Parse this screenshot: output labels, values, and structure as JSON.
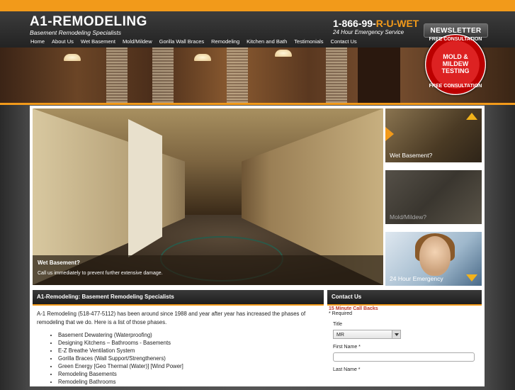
{
  "header": {
    "logo_title": "A1-REMODELING",
    "logo_subtitle": "Basement Remodeling Specialists",
    "phone_prefix": "1-866-99-",
    "phone_highlight": "R-U-WET",
    "phone_subtitle": "24 Hour Emergency Service",
    "newsletter_label": "NEWSLETTER"
  },
  "nav": {
    "items": [
      {
        "label": "Home"
      },
      {
        "label": "About Us"
      },
      {
        "label": "Wet Basement"
      },
      {
        "label": "Mold/Mildew"
      },
      {
        "label": "Gorilla Wall Braces"
      },
      {
        "label": "Remodeling"
      },
      {
        "label": "Kitchen and Bath"
      },
      {
        "label": "Testimonials"
      },
      {
        "label": "Contact Us"
      }
    ]
  },
  "badge": {
    "top_text": "FREE CONSULTATION",
    "line1": "MOLD &",
    "line2": "MILDEW",
    "line3": "TESTING",
    "bottom_text": "FREE CONSULTATION"
  },
  "hero": {
    "title": "Wet Basement?",
    "text": "Call us immediately to prevent further extensive damage."
  },
  "thumbs": [
    {
      "label": "Wet Basement?"
    },
    {
      "label": "Mold/Mildew?"
    },
    {
      "label": "24 Hour Emergency"
    }
  ],
  "main": {
    "heading": "A1-Remodeling: Basement Remodeling Specialists",
    "intro": "A-1 Remodeling (518-477-5112) has been around since 1988 and year after year has increased the phases of remodeling that we do. Here is a list of those phases.",
    "phases": [
      "Basement Dewatering (Waterproofing)",
      "Designing Kitchens – Bathrooms - Basements",
      "E-Z Breathe Ventilation System",
      "Gorilla Braces (Wall Support/Strengtheners)",
      "Green Energy [Geo Thermal (Water)] [Wind Power]",
      "Remodeling Basements",
      "Remodeling Bathrooms"
    ]
  },
  "contact": {
    "heading": "Contact Us",
    "callback": "15 Minute Call Backs",
    "required": "* Required",
    "title_label": "Title",
    "title_value": "MR",
    "first_name_label": "First Name *",
    "last_name_label": "Last Name *"
  },
  "colors": {
    "accent": "#f29a1a",
    "header_bg": "#2a2a2a",
    "callback_red": "#c0392b"
  }
}
